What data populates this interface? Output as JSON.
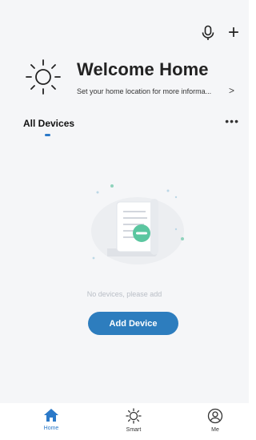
{
  "header": {
    "mic_icon": "microphone-icon",
    "add_icon": "plus-icon",
    "plus_glyph": "+"
  },
  "welcome": {
    "title": "Welcome Home",
    "subtitle": "Set your home location for more informa...",
    "chevron": ">"
  },
  "tabs": {
    "all_devices": "All Devices",
    "more": "•••"
  },
  "empty_state": {
    "message": "No devices, please add",
    "button": "Add Device"
  },
  "nav": {
    "home": "Home",
    "smart": "Smart",
    "me": "Me"
  },
  "colors": {
    "accent": "#2d7dbe",
    "background": "#f5f6f8",
    "muted_text": "#b9bec6",
    "illustration_green": "#5bc6a0"
  }
}
